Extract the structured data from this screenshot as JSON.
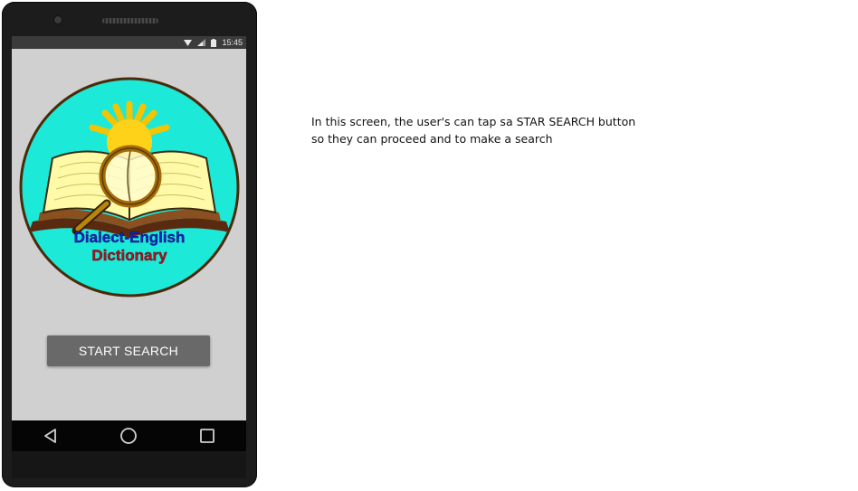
{
  "status_bar": {
    "time": "15:45"
  },
  "logo": {
    "line1": "Dialect-English",
    "line2": "Dictionary"
  },
  "main": {
    "start_button_label": "START SEARCH"
  },
  "nav": {
    "back": "back-icon",
    "home": "home-icon",
    "recents": "recents-icon"
  },
  "note": {
    "line1": "In this screen, the user's can tap sa STAR SEARCH button",
    "line2": "so they can proceed and to make a search"
  },
  "colors": {
    "logo_circle": "#1de9d8",
    "logo_text_blue": "#1a23c2",
    "logo_text_red": "#b4101f",
    "button": "#696969"
  }
}
